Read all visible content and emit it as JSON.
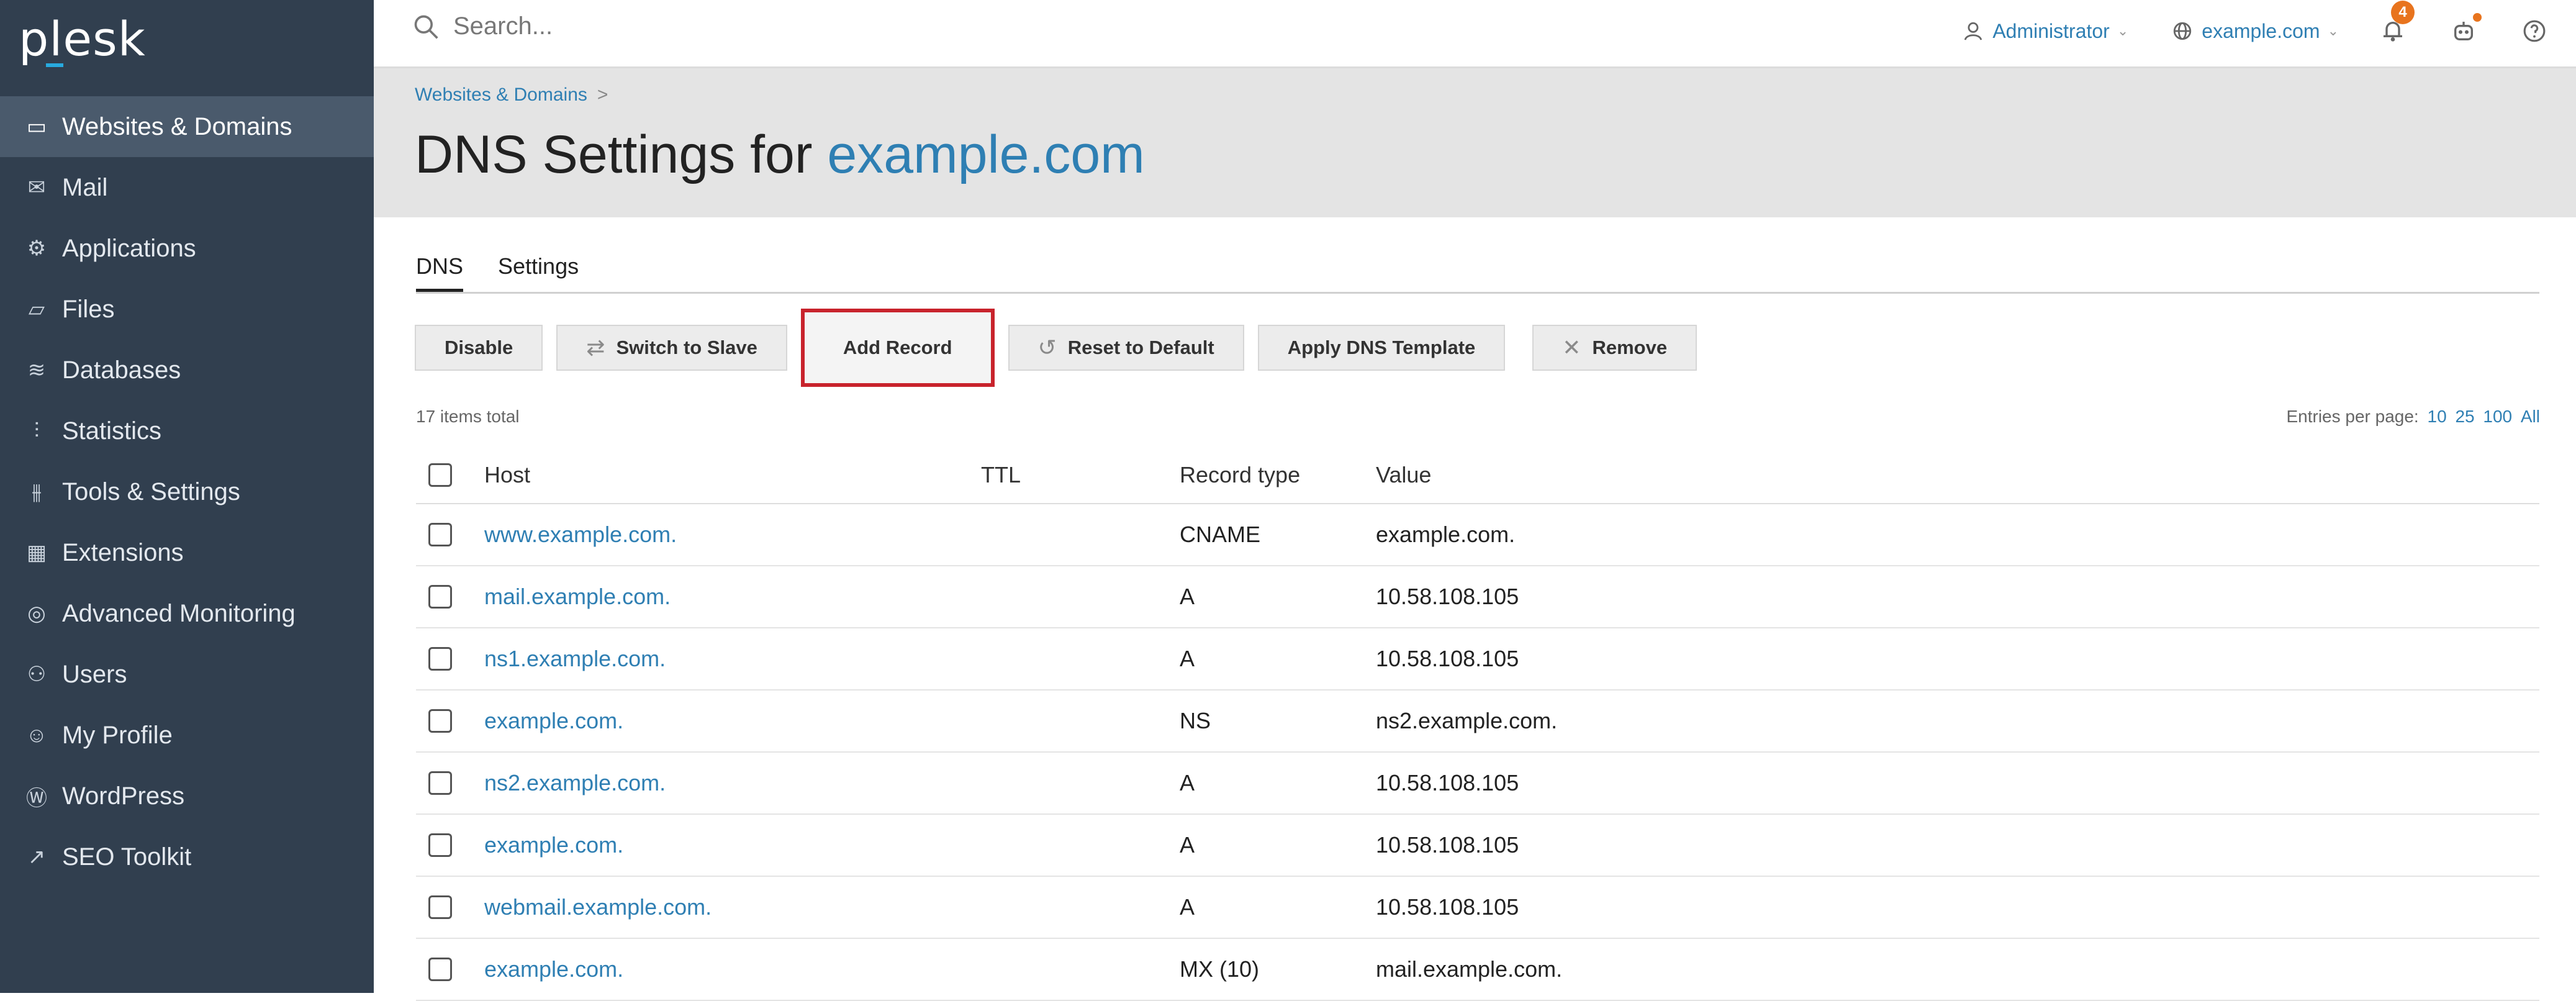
{
  "brand": {
    "logo": "plesk"
  },
  "sidebar": {
    "items": [
      {
        "label": "Websites & Domains",
        "icon": "monitor-icon",
        "glyph": "▭"
      },
      {
        "label": "Mail",
        "icon": "mail-icon",
        "glyph": "✉"
      },
      {
        "label": "Applications",
        "icon": "gear-icon",
        "glyph": "⚙"
      },
      {
        "label": "Files",
        "icon": "folder-icon",
        "glyph": "▱"
      },
      {
        "label": "Databases",
        "icon": "database-icon",
        "glyph": "≋"
      },
      {
        "label": "Statistics",
        "icon": "bar-chart-icon",
        "glyph": "⫶"
      },
      {
        "label": "Tools & Settings",
        "icon": "sliders-icon",
        "glyph": "⫵"
      },
      {
        "label": "Extensions",
        "icon": "blocks-icon",
        "glyph": "▦"
      },
      {
        "label": "Advanced Monitoring",
        "icon": "monitoring-icon",
        "glyph": "◎"
      },
      {
        "label": "Users",
        "icon": "user-icon",
        "glyph": "⚇"
      },
      {
        "label": "My Profile",
        "icon": "profile-icon",
        "glyph": "☺"
      },
      {
        "label": "WordPress",
        "icon": "wordpress-icon",
        "glyph": "Ⓦ"
      },
      {
        "label": "SEO Toolkit",
        "icon": "seo-chart-icon",
        "glyph": "↗"
      }
    ],
    "collapse_glyph": "‹"
  },
  "topbar": {
    "search_placeholder": "Search...",
    "user": "Administrator",
    "domain": "example.com",
    "notifications_count": "4"
  },
  "header": {
    "breadcrumb": "Websites & Domains",
    "breadcrumb_sep": ">",
    "title_prefix": "DNS Settings for",
    "title_domain": "example.com"
  },
  "tabs": [
    {
      "label": "DNS"
    },
    {
      "label": "Settings"
    }
  ],
  "toolbar": {
    "disable": "Disable",
    "switch_to_slave": "Switch to Slave",
    "add_record": "Add Record",
    "reset_to_default": "Reset to Default",
    "apply_dns_template": "Apply DNS Template",
    "remove": "Remove"
  },
  "list": {
    "items_total": "17 items total",
    "entries_label": "Entries per page:",
    "entries_options": [
      "10",
      "25",
      "100",
      "All"
    ],
    "columns": {
      "host": "Host",
      "ttl": "TTL",
      "type": "Record type",
      "value": "Value"
    },
    "rows": [
      {
        "host": "www.example.com.",
        "ttl": "",
        "type": "CNAME",
        "value": "example.com."
      },
      {
        "host": "mail.example.com.",
        "ttl": "",
        "type": "A",
        "value": "10.58.108.105"
      },
      {
        "host": "ns1.example.com.",
        "ttl": "",
        "type": "A",
        "value": "10.58.108.105"
      },
      {
        "host": "example.com.",
        "ttl": "",
        "type": "NS",
        "value": "ns2.example.com."
      },
      {
        "host": "ns2.example.com.",
        "ttl": "",
        "type": "A",
        "value": "10.58.108.105"
      },
      {
        "host": "example.com.",
        "ttl": "",
        "type": "A",
        "value": "10.58.108.105"
      },
      {
        "host": "webmail.example.com.",
        "ttl": "",
        "type": "A",
        "value": "10.58.108.105"
      },
      {
        "host": "example.com.",
        "ttl": "",
        "type": "MX (10)",
        "value": "mail.example.com."
      }
    ]
  }
}
